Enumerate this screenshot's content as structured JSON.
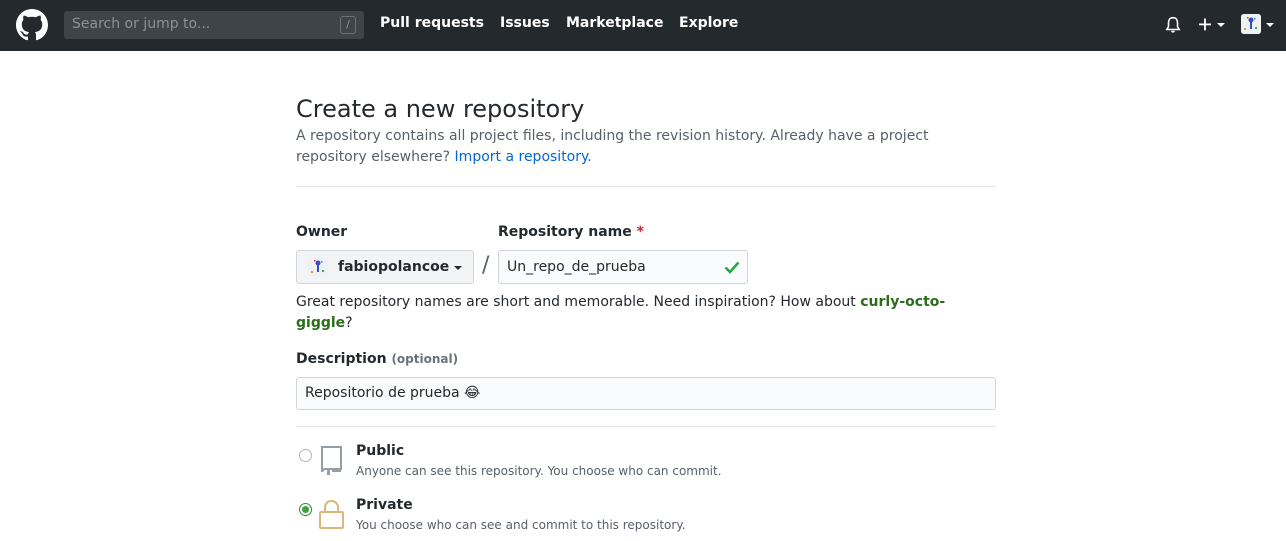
{
  "header": {
    "search_placeholder": "Search or jump to...",
    "search_shortcut": "/",
    "nav": [
      "Pull requests",
      "Issues",
      "Marketplace",
      "Explore"
    ]
  },
  "page": {
    "title": "Create a new repository",
    "subhead_text": "A repository contains all project files, including the revision history. Already have a project repository elsewhere? ",
    "import_link": "Import a repository."
  },
  "form": {
    "owner_label": "Owner",
    "owner_value": "fabiopolancoe",
    "repo_label": "Repository name",
    "required_mark": "*",
    "separator": "/",
    "repo_value": "Un_repo_de_prueba",
    "hint_prefix": "Great repository names are short and memorable. Need inspiration? How about ",
    "hint_suggestion": "curly-octo-giggle",
    "hint_suffix": "?",
    "description_label": "Description",
    "description_optional": "(optional)",
    "description_value": "Repositorio de prueba 😂"
  },
  "visibility": {
    "selected": "private",
    "options": [
      {
        "title": "Public",
        "desc": "Anyone can see this repository. You choose who can commit."
      },
      {
        "title": "Private",
        "desc": "You choose who can see and commit to this repository."
      }
    ]
  },
  "colors": {
    "header_bg": "#24292e",
    "link": "#0366d6",
    "success": "#28a745",
    "suggestion": "#2c6d1a"
  }
}
